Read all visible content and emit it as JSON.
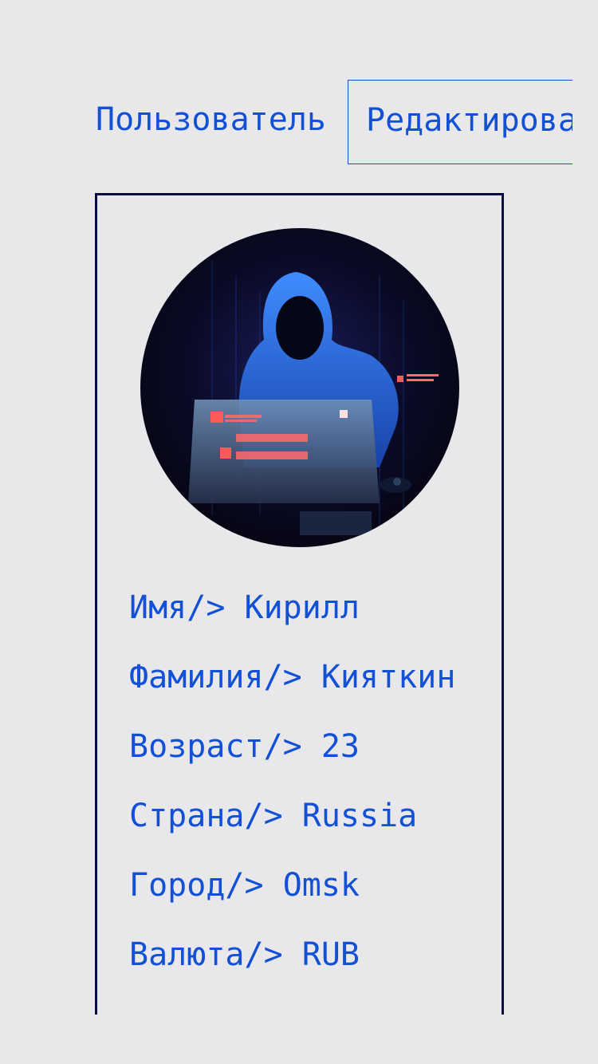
{
  "header": {
    "tabs": [
      {
        "label": "Пользователь",
        "active": false
      },
      {
        "label": "Редактирование",
        "active": true
      }
    ]
  },
  "profile": {
    "avatar_icon": "hooded-hacker-avatar",
    "fields": [
      {
        "label": "Имя",
        "separator": "/>",
        "value": "Кирилл"
      },
      {
        "label": "Фамилия",
        "separator": "/>",
        "value": "Кияткин"
      },
      {
        "label": "Возраст",
        "separator": "/>",
        "value": "23"
      },
      {
        "label": "Страна",
        "separator": "/>",
        "value": "Russia"
      },
      {
        "label": "Город",
        "separator": "/>",
        "value": "Omsk"
      },
      {
        "label": "Валюта",
        "separator": "/>",
        "value": "RUB"
      }
    ]
  },
  "colors": {
    "background": "#e8e8ea",
    "accent": "#1250d6",
    "card_border": "#0b0b44"
  }
}
